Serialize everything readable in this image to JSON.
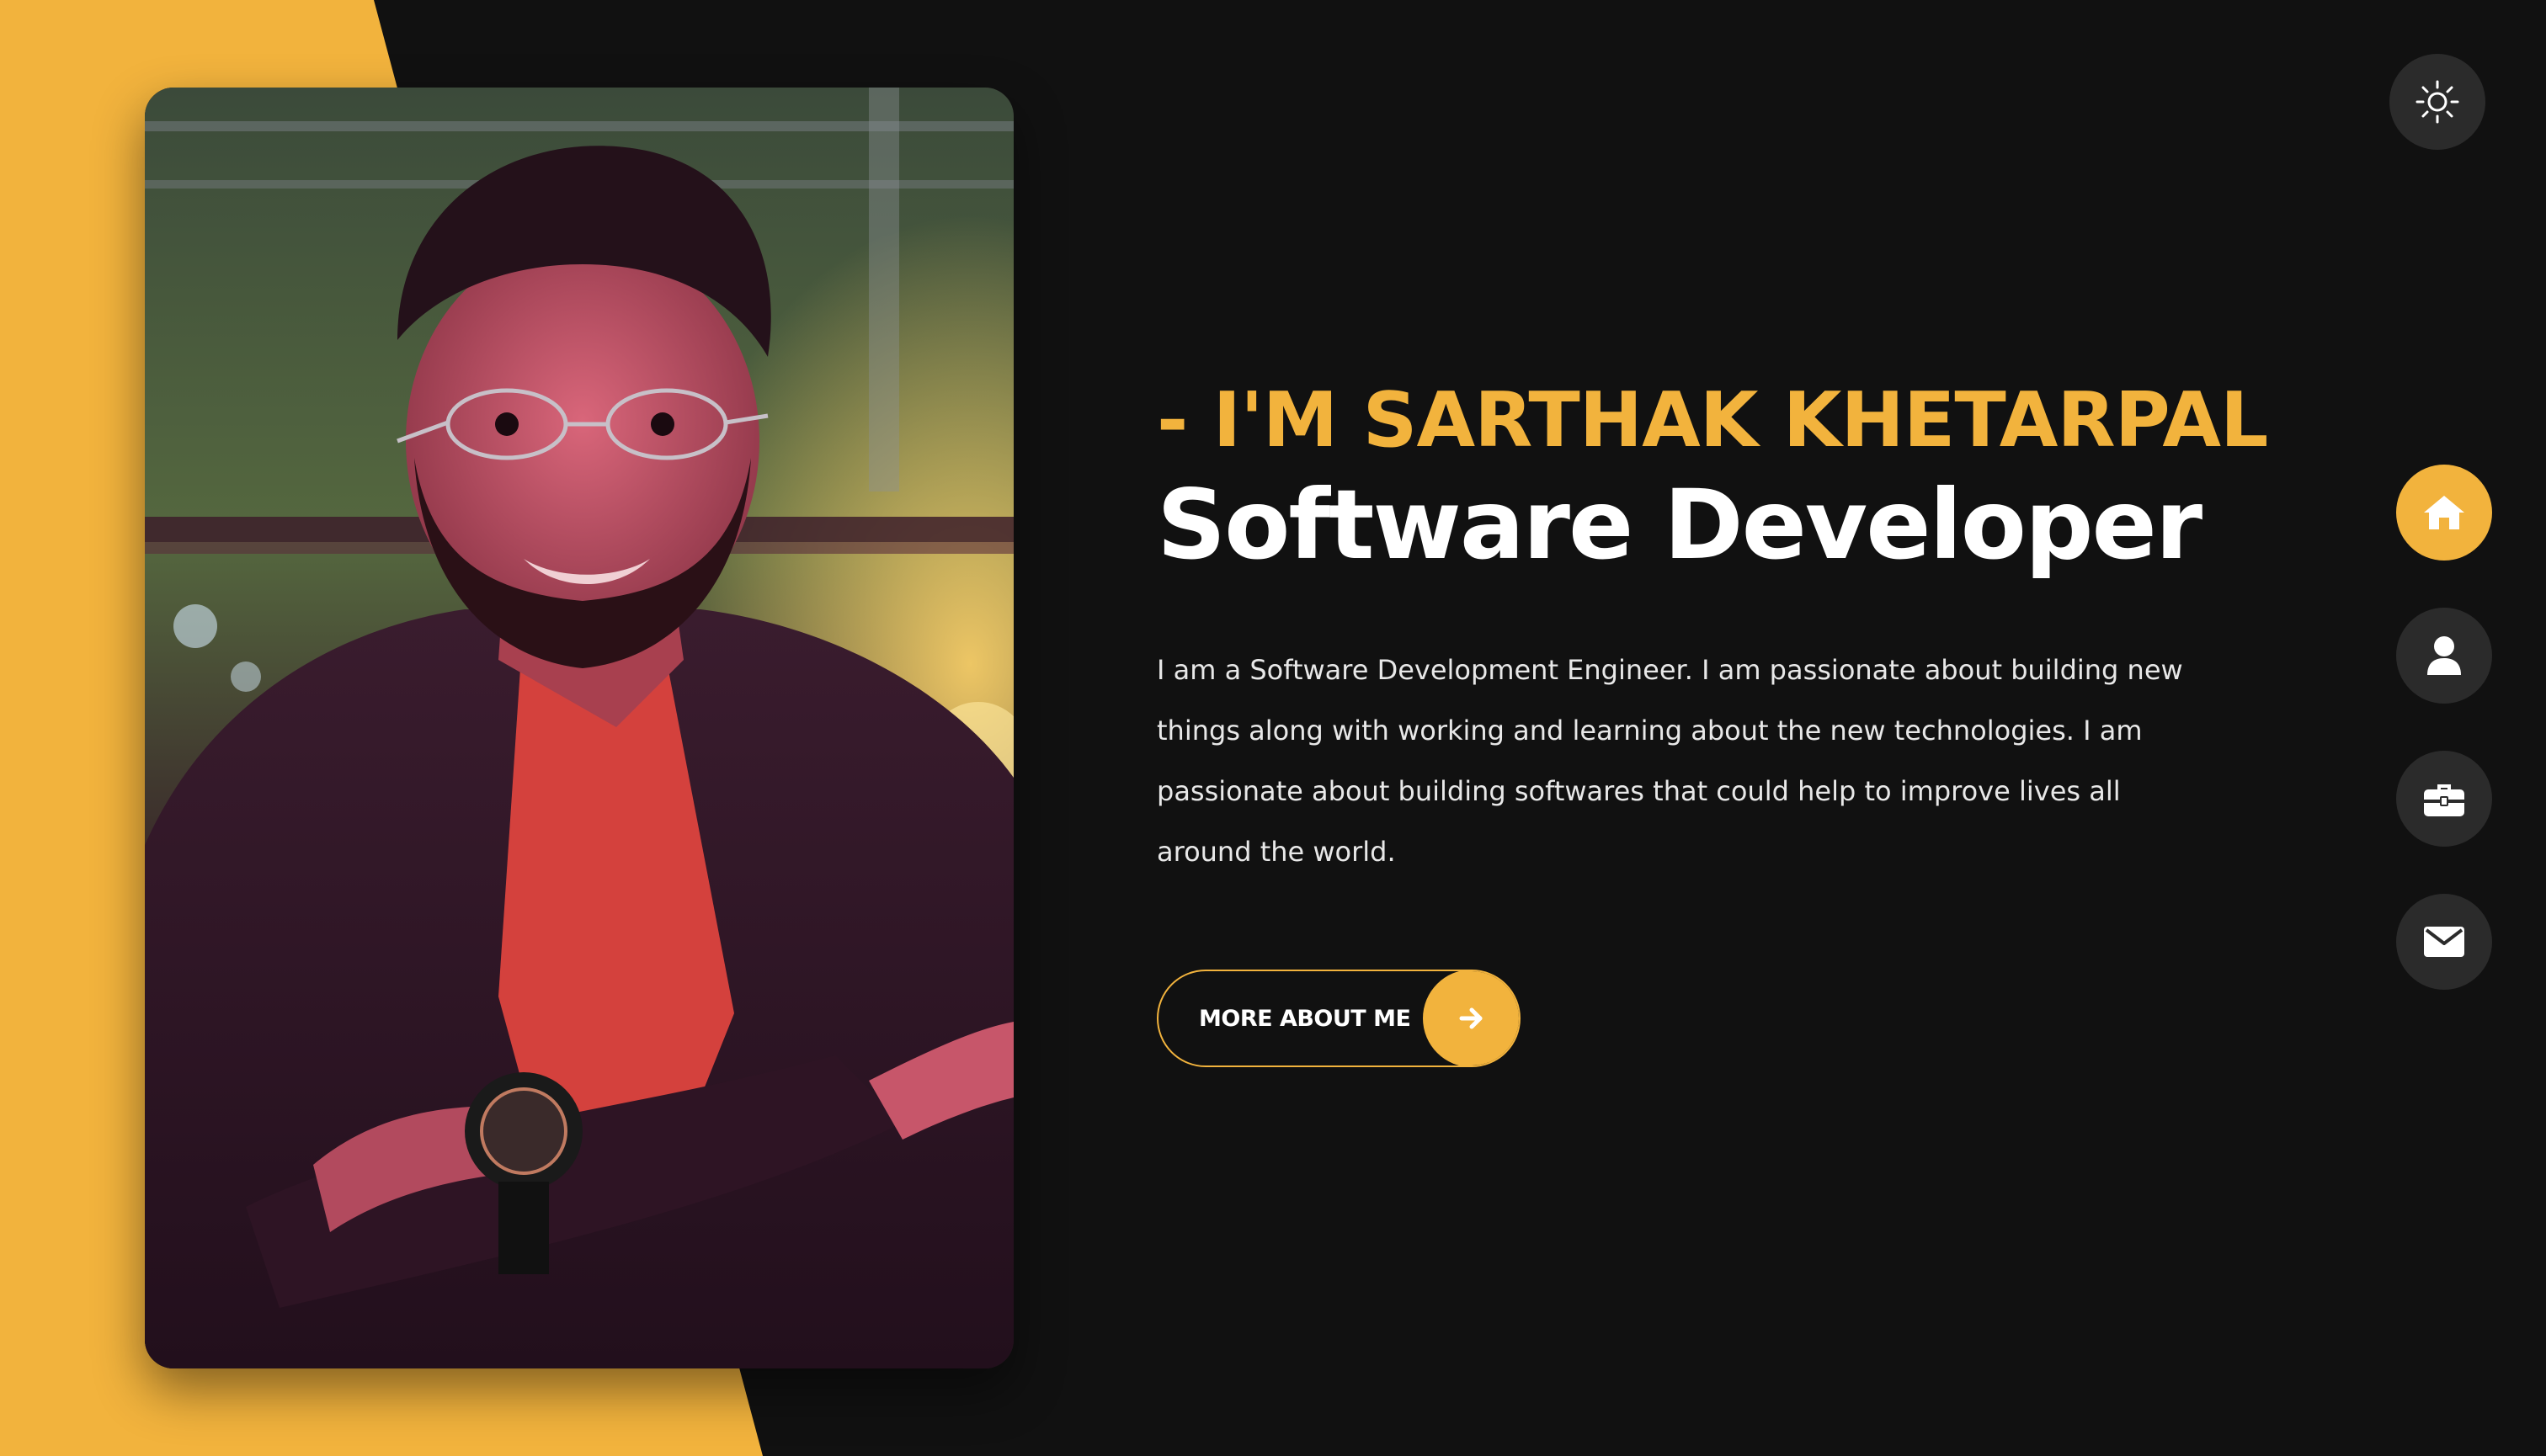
{
  "profile": {
    "photo_alt": "Portrait photo"
  },
  "header": {
    "theme_toggle_icon": "sun-icon"
  },
  "hero": {
    "kicker": "- I'M SARTHAK KHETARPAL",
    "title": "Software Developer",
    "description": "I am a Software Development Engineer. I am passionate about building new things along with working and learning about the new technologies. I am passionate about building softwares that could help to improve lives all around the world.",
    "cta_label": "MORE ABOUT ME",
    "cta_icon": "arrow-right-icon"
  },
  "side_nav": {
    "items": [
      {
        "icon": "home-icon",
        "active": true
      },
      {
        "icon": "user-icon",
        "active": false
      },
      {
        "icon": "briefcase-icon",
        "active": false
      },
      {
        "icon": "envelope-icon",
        "active": false
      }
    ]
  },
  "colors": {
    "accent": "#f2b33d",
    "background": "#111111",
    "button_bg": "#2b2b2b",
    "text": "#ffffff"
  }
}
